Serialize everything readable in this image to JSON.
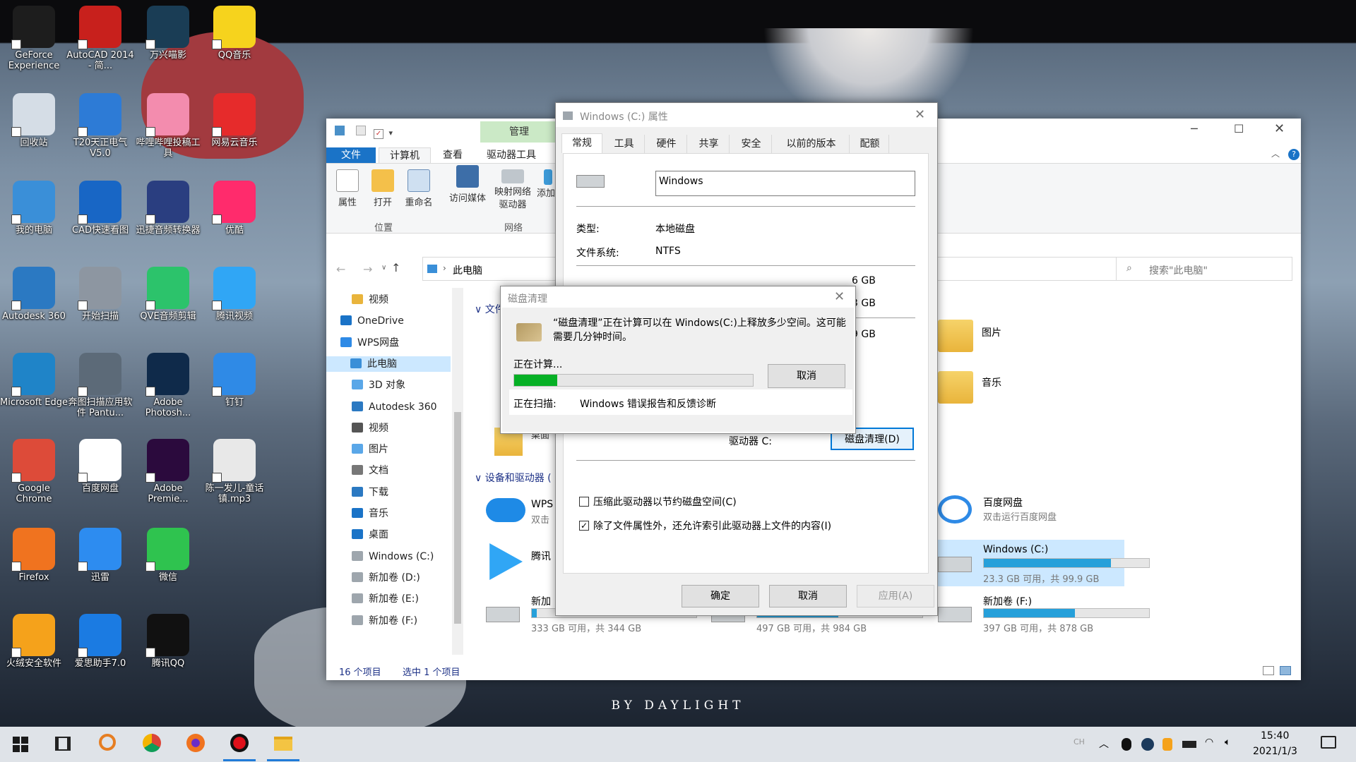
{
  "desktop": {
    "icons": [
      {
        "label": "GeForce Experience",
        "color": "#1d1d1d"
      },
      {
        "label": "AutoCAD 2014 - 简...",
        "color": "#c8201c"
      },
      {
        "label": "万兴喵影",
        "color": "#1a3d55"
      },
      {
        "label": "QQ音乐",
        "color": "#f6d31d"
      },
      {
        "label": "回收站",
        "color": "#d5dde6"
      },
      {
        "label": "T20天正电气 V5.0",
        "color": "#2d7bd6"
      },
      {
        "label": "哔哩哔哩投稿工具",
        "color": "#f38cae"
      },
      {
        "label": "网易云音乐",
        "color": "#e62b2b"
      },
      {
        "label": "我的电脑",
        "color": "#3a8fd8"
      },
      {
        "label": "CAD快速看图",
        "color": "#1866c5"
      },
      {
        "label": "迅捷音频转换器",
        "color": "#2a3e80"
      },
      {
        "label": "优酷",
        "color": "#ff2b6c"
      },
      {
        "label": "Autodesk 360",
        "color": "#2b79c2"
      },
      {
        "label": "开始扫描",
        "color": "#8d96a1"
      },
      {
        "label": "QVE音频剪辑",
        "color": "#2cc36b"
      },
      {
        "label": "腾讯视频",
        "color": "#30a6f5"
      },
      {
        "label": "Microsoft Edge",
        "color": "#1f84c8"
      },
      {
        "label": "奔图扫描应用软件 Pantu...",
        "color": "#5c6a78"
      },
      {
        "label": "Adobe Photosh...",
        "color": "#0f2a4a"
      },
      {
        "label": "钉钉",
        "color": "#2f8ae6"
      },
      {
        "label": "Google Chrome",
        "color": "#dd4b39"
      },
      {
        "label": "百度网盘",
        "color": "#ffffff"
      },
      {
        "label": "Adobe Premie...",
        "color": "#2b0a3d"
      },
      {
        "label": "陈一发儿-童话镇.mp3",
        "color": "#e8e8e8"
      },
      {
        "label": "Firefox",
        "color": "#f0731f"
      },
      {
        "label": "迅雷",
        "color": "#2d8cf0"
      },
      {
        "label": "微信",
        "color": "#2fc34f"
      },
      {
        "label": "火绒安全软件",
        "color": "#f5a21b"
      },
      {
        "label": "爱思助手7.0",
        "color": "#1b7be2"
      },
      {
        "label": "腾讯QQ",
        "color": "#111111"
      }
    ],
    "watermark": "BY DAYLIGHT"
  },
  "explorer": {
    "quick_access": "▾",
    "ribbon_context_group": "管理",
    "tabs": [
      "文件",
      "计算机",
      "查看",
      "驱动器工具"
    ],
    "ribbon_items": [
      {
        "label": "属性"
      },
      {
        "label": "打开"
      },
      {
        "label": "重命名"
      },
      {
        "label": "访问媒体"
      },
      {
        "label": "映射网络驱动器"
      },
      {
        "label": "添加网络"
      }
    ],
    "ribbon_groups": [
      "位置",
      "网络"
    ],
    "address": "此电脑",
    "search_placeholder": "搜索\"此电脑\"",
    "nav_items": [
      "视频",
      "OneDrive",
      "WPS网盘",
      "此电脑",
      "3D 对象",
      "Autodesk 360",
      "视频",
      "图片",
      "文档",
      "下载",
      "音乐",
      "桌面",
      "Windows (C:)",
      "新加卷 (D:)",
      "新加卷 (E:)",
      "新加卷 (F:)"
    ],
    "section_folders": "文件",
    "section_devices": "设备和驱动器 (",
    "folders_right": [
      "图片",
      "音乐"
    ],
    "partial_left_items": [
      "WPS",
      "双击",
      "腾讯",
      "新加",
      "桌面"
    ],
    "devices": [
      {
        "name": "百度网盘",
        "sub": "双击运行百度网盘"
      },
      {
        "name": "Windows (C:)",
        "sub": "23.3 GB 可用，共 99.9 GB",
        "used": 0.77
      },
      {
        "name": "新加卷 (F:)",
        "sub": "397 GB 可用，共 878 GB",
        "used": 0.55
      }
    ],
    "drive_d_sub": "333 GB 可用，共 344 GB",
    "drive_d_used": 0.03,
    "drive_e_sub": "497 GB 可用，共 984 GB",
    "drive_e_used": 0.49,
    "status_count": "16 个项目",
    "status_selected": "选中 1 个项目"
  },
  "props": {
    "title": "Windows (C:) 属性",
    "tabs": [
      "常规",
      "工具",
      "硬件",
      "共享",
      "安全",
      "以前的版本",
      "配额"
    ],
    "name_value": "Windows",
    "type_label": "类型:",
    "type_value": "本地磁盘",
    "fs_label": "文件系统:",
    "fs_value": "NTFS",
    "size_partial_1": "6 GB",
    "size_partial_2": "3 GB",
    "size_partial_3": "9 GB",
    "drive_label": "驱动器 C:",
    "cleanup_button": "磁盘清理(D)",
    "compress_label": "压缩此驱动器以节约磁盘空间(C)",
    "index_label": "除了文件属性外，还允许索引此驱动器上文件的内容(I)",
    "ok": "确定",
    "cancel": "取消",
    "apply": "应用(A)"
  },
  "cleanup": {
    "title": "磁盘清理",
    "message": "“磁盘清理”正在计算可以在 Windows(C:)上释放多少空间。这可能需要几分钟时间。",
    "calculating": "正在计算...",
    "cancel": "取消",
    "progress": 0.18,
    "scanning_label": "正在扫描:",
    "scanning_value": "Windows 错误报告和反馈诊断"
  },
  "taskbar": {
    "ime": "CH",
    "time": "15:40",
    "date": "2021/1/3"
  }
}
